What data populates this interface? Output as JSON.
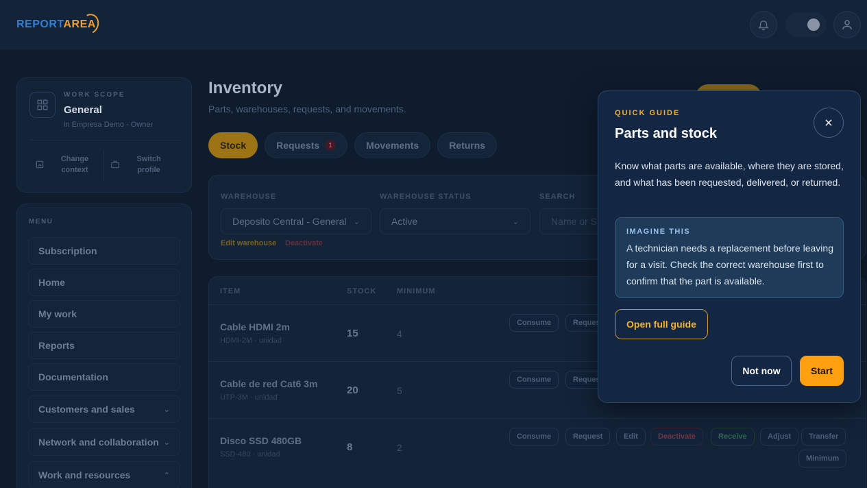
{
  "brand": {
    "part1": "REPORT",
    "part2": "AREA"
  },
  "topbar": {
    "icons": [
      "bell-icon",
      "theme-toggle",
      "user-icon"
    ]
  },
  "scope": {
    "kicker": "WORK SCOPE",
    "name": "General",
    "subtitle": "in Empresa Demo - Owner",
    "change_label": "Change context",
    "switch_label": "Switch profile"
  },
  "menu": {
    "kicker": "MENU",
    "items": [
      {
        "label": "Subscription"
      },
      {
        "label": "Home"
      },
      {
        "label": "My work"
      },
      {
        "label": "Reports"
      },
      {
        "label": "Documentation"
      },
      {
        "label": "Customers and sales"
      },
      {
        "label": "Network and collaboration"
      },
      {
        "label": "Work and resources"
      }
    ]
  },
  "page": {
    "title": "Inventory",
    "subtitle": "Parts, warehouses, requests, and movements."
  },
  "tabs": [
    {
      "label": "Stock"
    },
    {
      "label": "Requests",
      "badge": "1"
    },
    {
      "label": "Movements"
    },
    {
      "label": "Returns"
    }
  ],
  "filters": {
    "warehouse_label": "WAREHOUSE",
    "warehouse_value": "Deposito Central - General",
    "status_label": "WAREHOUSE STATUS",
    "status_value": "Active",
    "search_label": "SEARCH",
    "search_placeholder": "Name or SKU",
    "edit_link": "Edit warehouse",
    "deactivate_link": "Deactivate"
  },
  "table": {
    "headers": {
      "item": "ITEM",
      "stock": "STOCK",
      "minimum": "MINIMUM"
    },
    "rows": [
      {
        "name": "Cable HDMI 2m",
        "sku": "HDMI-2M · unidad",
        "stock": "15",
        "minimum": "4"
      },
      {
        "name": "Cable de red Cat6 3m",
        "sku": "UTP-3M · unidad",
        "stock": "20",
        "minimum": "5"
      },
      {
        "name": "Disco SSD 480GB",
        "sku": "SSD-480 · unidad",
        "stock": "8",
        "minimum": "2"
      }
    ],
    "actions": {
      "consume": "Consume",
      "request": "Request",
      "edit": "Edit",
      "deactivate": "Deactivate",
      "receive": "Receive",
      "adjust": "Adjust",
      "transfer": "Transfer",
      "minimum": "Minimum"
    }
  },
  "guide": {
    "kicker": "QUICK GUIDE",
    "title": "Parts and stock",
    "body": "Know what parts are available, where they are stored, and what has been requested, delivered, or returned.",
    "box_kicker": "IMAGINE THIS",
    "box_text": "A technician needs a replacement before leaving for a visit. Check the correct warehouse first to confirm that the part is available.",
    "open_label": "Open full guide",
    "not_now_label": "Not now",
    "start_label": "Start"
  },
  "colors": {
    "accent": "#ffa010",
    "brand_blue": "#2f7fd6",
    "background": "#0f1c2e"
  }
}
